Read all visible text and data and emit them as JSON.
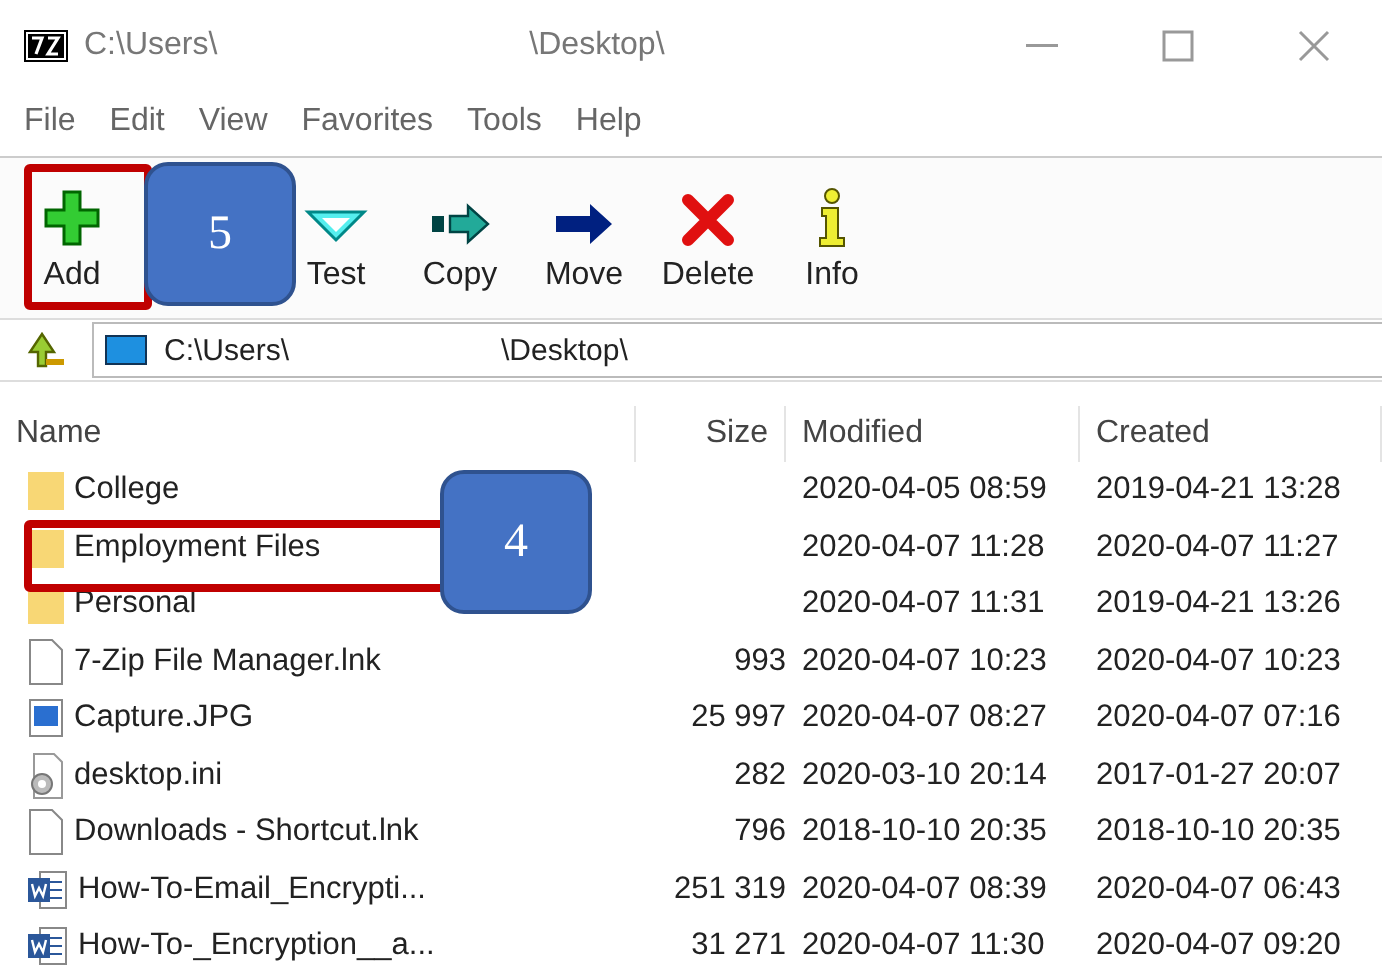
{
  "window": {
    "title_parts": [
      "C:\\Users\\",
      "\\Desktop\\"
    ]
  },
  "menu": [
    "File",
    "Edit",
    "View",
    "Favorites",
    "Tools",
    "Help"
  ],
  "toolbar": [
    {
      "label": "Add",
      "kind": "add"
    },
    {
      "kind": "hidden"
    },
    {
      "label": "Test",
      "kind": "test"
    },
    {
      "label": "Copy",
      "kind": "copy"
    },
    {
      "label": "Move",
      "kind": "move"
    },
    {
      "label": "Delete",
      "kind": "delete"
    },
    {
      "label": "Info",
      "kind": "info"
    }
  ],
  "address": {
    "parts": [
      "C:\\Users\\",
      "\\Desktop\\"
    ]
  },
  "table": {
    "columns": [
      "Name",
      "Size",
      "Modified",
      "Created"
    ],
    "rows": [
      {
        "kind": "folder",
        "name": "College",
        "size": "",
        "modified": "2020-04-05 08:59",
        "created": "2019-04-21 13:28"
      },
      {
        "kind": "folder",
        "name": "Employment Files",
        "size": "",
        "modified": "2020-04-07 11:28",
        "created": "2020-04-07 11:27"
      },
      {
        "kind": "folder",
        "name": "Personal",
        "size": "",
        "modified": "2020-04-07 11:31",
        "created": "2019-04-21 13:26"
      },
      {
        "kind": "file",
        "name": "7-Zip File Manager.lnk",
        "size": "993",
        "modified": "2020-04-07 10:23",
        "created": "2020-04-07 10:23"
      },
      {
        "kind": "image",
        "name": "Capture.JPG",
        "size": "25 997",
        "modified": "2020-04-07 08:27",
        "created": "2020-04-07 07:16"
      },
      {
        "kind": "settings",
        "name": "desktop.ini",
        "size": "282",
        "modified": "2020-03-10 20:14",
        "created": "2017-01-27 20:07"
      },
      {
        "kind": "file",
        "name": "Downloads - Shortcut.lnk",
        "size": "796",
        "modified": "2018-10-10 20:35",
        "created": "2018-10-10 20:35"
      },
      {
        "kind": "word",
        "name": "How-To-Email_Encrypti...",
        "size": "251 319",
        "modified": "2020-04-07 08:39",
        "created": "2020-04-07 06:43"
      },
      {
        "kind": "word",
        "name": "How-To-_Encryption__a...",
        "size": "31 271",
        "modified": "2020-04-07 11:30",
        "created": "2020-04-07 09:20"
      }
    ]
  },
  "callouts": [
    {
      "label": "5"
    },
    {
      "label": "4"
    }
  ]
}
